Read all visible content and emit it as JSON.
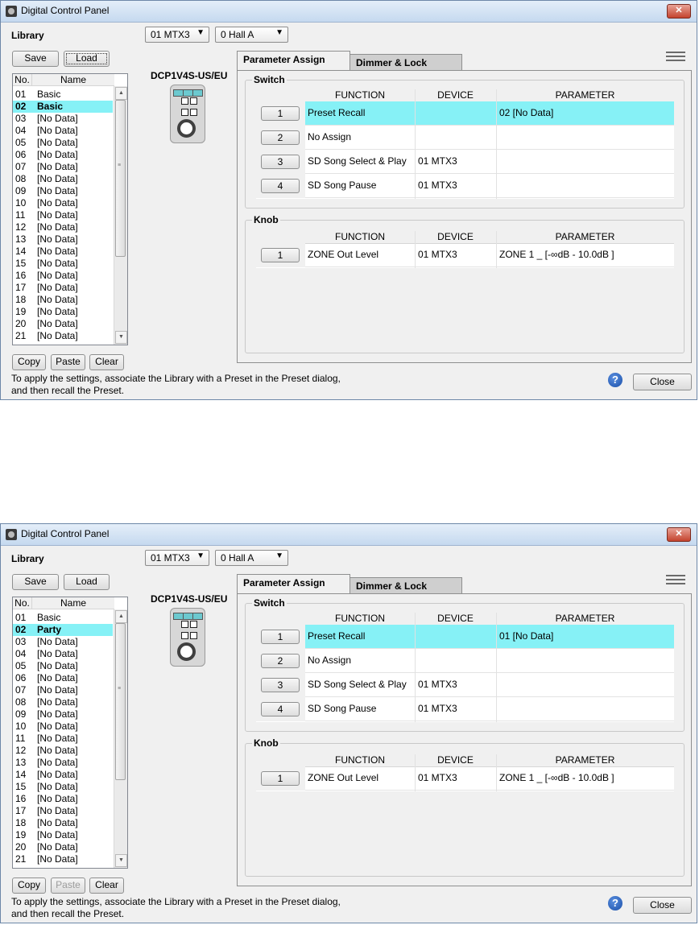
{
  "window_title": "Digital Control Panel",
  "library_label": "Library",
  "device_dropdown": "01 MTX3",
  "preset_dropdown": "0 Hall A",
  "save_label": "Save",
  "load_label": "Load",
  "list_header_no": "No.",
  "list_header_name": "Name",
  "device_model": "DCP1V4S-US/EU",
  "tabs": [
    "Parameter Assign",
    "Dimmer & Lock"
  ],
  "switch_title": "Switch",
  "knob_title": "Knob",
  "col_function": "FUNCTION",
  "col_device": "DEVICE",
  "col_parameter": "PARAMETER",
  "copy_label": "Copy",
  "paste_label": "Paste",
  "clear_label": "Clear",
  "close_label": "Close",
  "help_symbol": "?",
  "status_line1": "To apply the settings, associate the Library with a Preset in the Preset dialog,",
  "status_line2": "and then recall the Preset.",
  "highlight_color": "#86f1f6",
  "panels": [
    {
      "library": [
        {
          "no": "01",
          "name": "Basic"
        },
        {
          "no": "02",
          "name": "Basic"
        },
        {
          "no": "03",
          "name": "[No Data]"
        },
        {
          "no": "04",
          "name": "[No Data]"
        },
        {
          "no": "05",
          "name": "[No Data]"
        },
        {
          "no": "06",
          "name": "[No Data]"
        },
        {
          "no": "07",
          "name": "[No Data]"
        },
        {
          "no": "08",
          "name": "[No Data]"
        },
        {
          "no": "09",
          "name": "[No Data]"
        },
        {
          "no": "10",
          "name": "[No Data]"
        },
        {
          "no": "11",
          "name": "[No Data]"
        },
        {
          "no": "12",
          "name": "[No Data]"
        },
        {
          "no": "13",
          "name": "[No Data]"
        },
        {
          "no": "14",
          "name": "[No Data]"
        },
        {
          "no": "15",
          "name": "[No Data]"
        },
        {
          "no": "16",
          "name": "[No Data]"
        },
        {
          "no": "17",
          "name": "[No Data]"
        },
        {
          "no": "18",
          "name": "[No Data]"
        },
        {
          "no": "19",
          "name": "[No Data]"
        },
        {
          "no": "20",
          "name": "[No Data]"
        },
        {
          "no": "21",
          "name": "[No Data]"
        }
      ],
      "selected_row": 1,
      "paste_enabled": true,
      "load_focused": true,
      "switch_rows": [
        {
          "btn": "1",
          "function": "Preset Recall",
          "device": "",
          "parameter": "02 [No Data]"
        },
        {
          "btn": "2",
          "function": "No Assign",
          "device": "",
          "parameter": ""
        },
        {
          "btn": "3",
          "function": "SD Song Select & Play",
          "device": "01 MTX3",
          "parameter": ""
        },
        {
          "btn": "4",
          "function": "SD Song Pause",
          "device": "01 MTX3",
          "parameter": ""
        }
      ],
      "knob_rows": [
        {
          "btn": "1",
          "function": "ZONE Out Level",
          "device": "01 MTX3",
          "parameter": "ZONE 1 _ [-∞dB - 10.0dB ]"
        }
      ]
    },
    {
      "library": [
        {
          "no": "01",
          "name": "Basic"
        },
        {
          "no": "02",
          "name": "Party"
        },
        {
          "no": "03",
          "name": "[No Data]"
        },
        {
          "no": "04",
          "name": "[No Data]"
        },
        {
          "no": "05",
          "name": "[No Data]"
        },
        {
          "no": "06",
          "name": "[No Data]"
        },
        {
          "no": "07",
          "name": "[No Data]"
        },
        {
          "no": "08",
          "name": "[No Data]"
        },
        {
          "no": "09",
          "name": "[No Data]"
        },
        {
          "no": "10",
          "name": "[No Data]"
        },
        {
          "no": "11",
          "name": "[No Data]"
        },
        {
          "no": "12",
          "name": "[No Data]"
        },
        {
          "no": "13",
          "name": "[No Data]"
        },
        {
          "no": "14",
          "name": "[No Data]"
        },
        {
          "no": "15",
          "name": "[No Data]"
        },
        {
          "no": "16",
          "name": "[No Data]"
        },
        {
          "no": "17",
          "name": "[No Data]"
        },
        {
          "no": "18",
          "name": "[No Data]"
        },
        {
          "no": "19",
          "name": "[No Data]"
        },
        {
          "no": "20",
          "name": "[No Data]"
        },
        {
          "no": "21",
          "name": "[No Data]"
        }
      ],
      "selected_row": 1,
      "paste_enabled": false,
      "load_focused": false,
      "switch_rows": [
        {
          "btn": "1",
          "function": "Preset Recall",
          "device": "",
          "parameter": "01 [No Data]"
        },
        {
          "btn": "2",
          "function": "No Assign",
          "device": "",
          "parameter": ""
        },
        {
          "btn": "3",
          "function": "SD Song Select & Play",
          "device": "01 MTX3",
          "parameter": ""
        },
        {
          "btn": "4",
          "function": "SD Song Pause",
          "device": "01 MTX3",
          "parameter": ""
        }
      ],
      "knob_rows": [
        {
          "btn": "1",
          "function": "ZONE Out Level",
          "device": "01 MTX3",
          "parameter": "ZONE 1 _ [-∞dB - 10.0dB ]"
        }
      ]
    }
  ]
}
